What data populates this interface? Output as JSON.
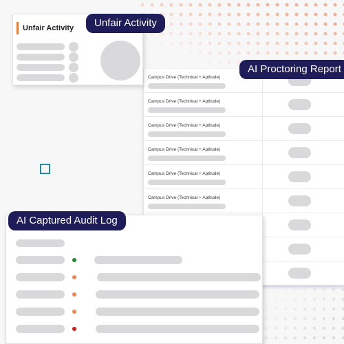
{
  "unfair_activity": {
    "badge": "Unfair Activity",
    "card_title": "Unfair Activity"
  },
  "proctoring_report": {
    "badge": "AI Proctoring Report",
    "rows": [
      {
        "label": "Campus Drive (Technical + Aptitude)"
      },
      {
        "label": "Campus Drive (Technical + Aptitude)"
      },
      {
        "label": "Campus Drive (Technical + Aptitude)"
      },
      {
        "label": "Campus Drive (Technical + Aptitude)"
      },
      {
        "label": "Campus Drive (Technical + Aptitude)"
      },
      {
        "label": "Campus Drive (Technical + Aptitude)"
      },
      {
        "label": ""
      },
      {
        "label": ""
      },
      {
        "label": ""
      }
    ]
  },
  "audit_log": {
    "badge": "AI Captured Audit Log",
    "entries": [
      {
        "status": "green",
        "color": "#1e8a2e"
      },
      {
        "status": "orange",
        "color": "#ef8550"
      },
      {
        "status": "orange",
        "color": "#ef8550"
      },
      {
        "status": "orange",
        "color": "#ef8550"
      },
      {
        "status": "red",
        "color": "#d8191c"
      }
    ]
  },
  "colors": {
    "badge_bg": "#1f1c5a",
    "accent_orange": "#f07c3a",
    "teal_square": "#1f8ea0",
    "skeleton": "#d9d9db"
  },
  "icons": {
    "decorative_square": "square-outline-icon",
    "status_dot": "status-dot-icon"
  }
}
